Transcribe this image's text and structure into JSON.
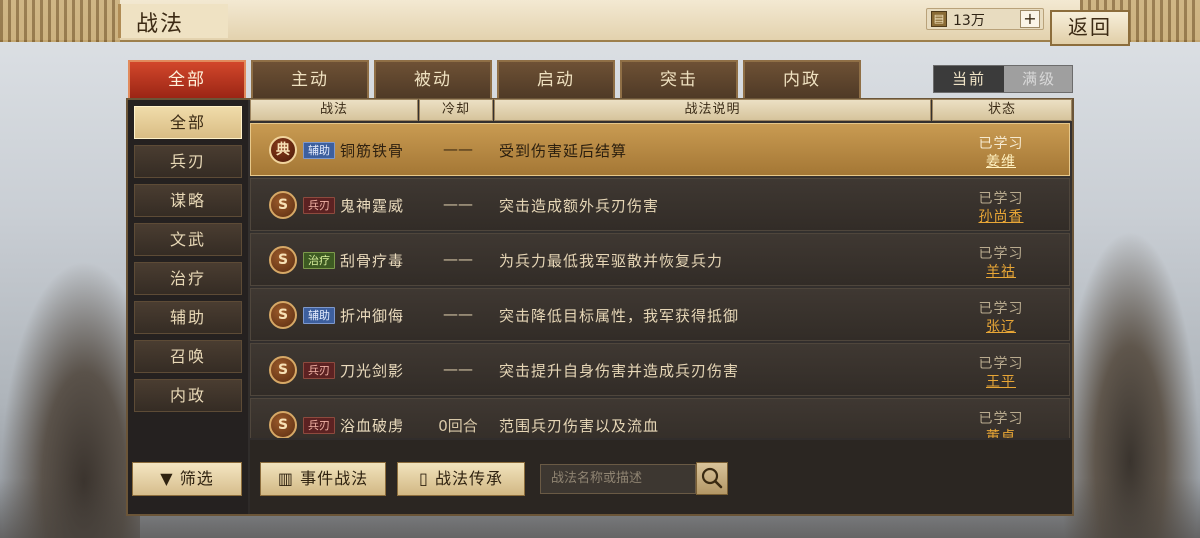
{
  "header": {
    "title": "战法",
    "currency_value": "13万",
    "add_label": "+",
    "back_label": "返回"
  },
  "tabs": [
    "全部",
    "主动",
    "被动",
    "启动",
    "突击",
    "内政"
  ],
  "toggle": {
    "current": "当前",
    "max": "满级"
  },
  "sidebar": {
    "items": [
      "全部",
      "兵刃",
      "谋略",
      "文武",
      "治疗",
      "辅助",
      "召唤",
      "内政"
    ],
    "filter_label": "筛选"
  },
  "table": {
    "headers": [
      "战法",
      "冷却",
      "战法说明",
      "状态"
    ],
    "rows": [
      {
        "badge": "典",
        "tag": "辅助",
        "tag_type": "blue",
        "name": "铜筋铁骨",
        "cooldown": "——",
        "desc": "受到伤害延后结算",
        "state": "已学习",
        "owner": "姜维"
      },
      {
        "badge": "S",
        "tag": "兵刃",
        "tag_type": "red",
        "name": "鬼神霆威",
        "cooldown": "——",
        "desc": "突击造成额外兵刃伤害",
        "state": "已学习",
        "owner": "孙尚香"
      },
      {
        "badge": "S",
        "tag": "治疗",
        "tag_type": "green",
        "name": "刮骨疗毒",
        "cooldown": "——",
        "desc": "为兵力最低我军驱散并恢复兵力",
        "state": "已学习",
        "owner": "羊祜"
      },
      {
        "badge": "S",
        "tag": "辅助",
        "tag_type": "blue",
        "name": "折冲御侮",
        "cooldown": "——",
        "desc": "突击降低目标属性，我军获得抵御",
        "state": "已学习",
        "owner": "张辽"
      },
      {
        "badge": "S",
        "tag": "兵刃",
        "tag_type": "red",
        "name": "刀光剑影",
        "cooldown": "——",
        "desc": "突击提升自身伤害并造成兵刃伤害",
        "state": "已学习",
        "owner": "王平"
      },
      {
        "badge": "S",
        "tag": "兵刃",
        "tag_type": "red",
        "name": "浴血破虏",
        "cooldown": "0回合",
        "desc": "范围兵刃伤害以及流血",
        "state": "已学习",
        "owner": "董卓"
      }
    ]
  },
  "bottom": {
    "event_label": "事件战法",
    "inherit_label": "战法传承",
    "search_placeholder": "战法名称或描述"
  },
  "icons": {
    "currency": "scroll-icon",
    "search": "search-icon",
    "filter": "funnel-icon",
    "event": "bars-icon",
    "inherit": "book-icon"
  },
  "colors": {
    "active_tab": "#c0381f",
    "selected_row": "#b88943",
    "owner_text": "#e8a636"
  }
}
